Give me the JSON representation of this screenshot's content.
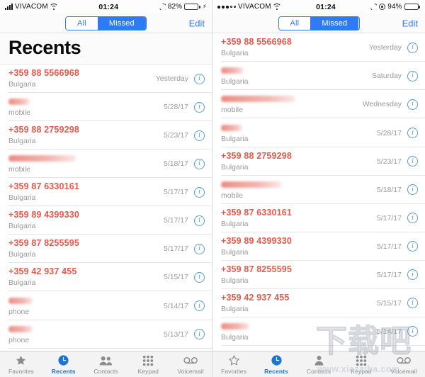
{
  "panels": [
    {
      "id": "left",
      "status": {
        "signal_style": "bars",
        "carrier": "VIVACOM",
        "wifi": true,
        "time": "01:24",
        "dnd": true,
        "rotation_lock": false,
        "battery_pct": "82%",
        "battery_level": 82,
        "battery_color": "#4cd464",
        "charging": true
      },
      "nav": {
        "seg_all": "All",
        "seg_missed": "Missed",
        "active_segment": "Missed",
        "edit": "Edit"
      },
      "big_title": "Recents",
      "show_big_title": true,
      "rows": [
        {
          "title": "+359 88 5566968",
          "redacted": false,
          "sub": "Bulgaria",
          "when": "Yesterday"
        },
        {
          "title": "",
          "redacted": true,
          "redact_width": 30,
          "sub": "mobile",
          "when": "5/28/17"
        },
        {
          "title": "+359 88 2759298",
          "redacted": false,
          "sub": "Bulgaria",
          "when": "5/23/17"
        },
        {
          "title": "",
          "redacted": true,
          "redact_width": 95,
          "sub": "mobile",
          "when": "5/18/17"
        },
        {
          "title": "+359 87 6330161",
          "redacted": false,
          "sub": "Bulgaria",
          "when": "5/17/17"
        },
        {
          "title": "+359 89 4399330",
          "redacted": false,
          "sub": "Bulgaria",
          "when": "5/17/17"
        },
        {
          "title": "+359 87 8255595",
          "redacted": false,
          "sub": "Bulgaria",
          "when": "5/17/17"
        },
        {
          "title": "+359 42 937 455",
          "redacted": false,
          "sub": "Bulgaria",
          "when": "5/15/17"
        },
        {
          "title": "",
          "redacted": true,
          "redact_width": 34,
          "sub": "phone",
          "when": "5/14/17"
        },
        {
          "title": "",
          "redacted": true,
          "redact_width": 34,
          "sub": "phone",
          "when": "5/13/17"
        }
      ],
      "tabs": [
        {
          "label": "Favorites",
          "icon": "star-icon",
          "active": false,
          "style": "filled"
        },
        {
          "label": "Recents",
          "icon": "clock-icon",
          "active": true,
          "style": "filled"
        },
        {
          "label": "Contacts",
          "icon": "contacts-icon",
          "active": false,
          "style": "filled"
        },
        {
          "label": "Keypad",
          "icon": "keypad-icon",
          "active": false,
          "style": "filled"
        },
        {
          "label": "Voicemail",
          "icon": "voicemail-icon",
          "active": false,
          "style": "filled"
        }
      ],
      "watermark": null
    },
    {
      "id": "right",
      "status": {
        "signal_style": "dots",
        "carrier": "VIVACOM",
        "wifi": true,
        "time": "01:24",
        "dnd": true,
        "rotation_lock": true,
        "battery_pct": "94%",
        "battery_level": 94,
        "battery_color": "#111111",
        "charging": false
      },
      "nav": {
        "seg_all": "All",
        "seg_missed": "Missed",
        "active_segment": "Missed",
        "edit": "Edit"
      },
      "big_title": "",
      "show_big_title": false,
      "rows": [
        {
          "title": "+359 88 5566968",
          "redacted": false,
          "sub": "Bulgaria",
          "when": "Yesterday"
        },
        {
          "title": "",
          "redacted": true,
          "redact_width": 32,
          "sub": "Bulgaria",
          "when": "Saturday"
        },
        {
          "title": "",
          "redacted": true,
          "redact_width": 105,
          "sub": "mobile",
          "when": "Wednesday"
        },
        {
          "title": "",
          "redacted": true,
          "redact_width": 30,
          "sub": "Bulgaria",
          "when": "5/28/17"
        },
        {
          "title": "+359 88 2759298",
          "redacted": false,
          "sub": "Bulgaria",
          "when": "5/23/17"
        },
        {
          "title": "",
          "redacted": true,
          "redact_width": 85,
          "sub": "mobile",
          "when": "5/18/17"
        },
        {
          "title": "+359 87 6330161",
          "redacted": false,
          "sub": "Bulgaria",
          "when": "5/17/17"
        },
        {
          "title": "+359 89 4399330",
          "redacted": false,
          "sub": "Bulgaria",
          "when": "5/17/17"
        },
        {
          "title": "+359 87 8255595",
          "redacted": false,
          "sub": "Bulgaria",
          "when": "5/17/17"
        },
        {
          "title": "+359 42 937 455",
          "redacted": false,
          "sub": "Bulgaria",
          "when": "5/15/17"
        },
        {
          "title": "",
          "redacted": true,
          "redact_width": 40,
          "sub": "Bulgaria",
          "when": "5/14/17"
        }
      ],
      "tabs": [
        {
          "label": "Favorites",
          "icon": "star-icon",
          "active": false,
          "style": "outline"
        },
        {
          "label": "Recents",
          "icon": "clock-icon",
          "active": true,
          "style": "filled"
        },
        {
          "label": "Contacts",
          "icon": "person-icon",
          "active": false,
          "style": "filled"
        },
        {
          "label": "Keypad",
          "icon": "keypad-icon",
          "active": false,
          "style": "filled"
        },
        {
          "label": "Voicemail",
          "icon": "voicemail-icon",
          "active": false,
          "style": "filled"
        }
      ],
      "watermark": {
        "cn": "下载吧",
        "url": "www.xiazaiba.com"
      }
    }
  ],
  "colors": {
    "accent_blue": "#2f7bf5",
    "call_red": "#e8594b",
    "tab_active": "#1b76d2",
    "info_blue": "#5b9bd5",
    "subtitle_gray": "#9a9a9a"
  }
}
